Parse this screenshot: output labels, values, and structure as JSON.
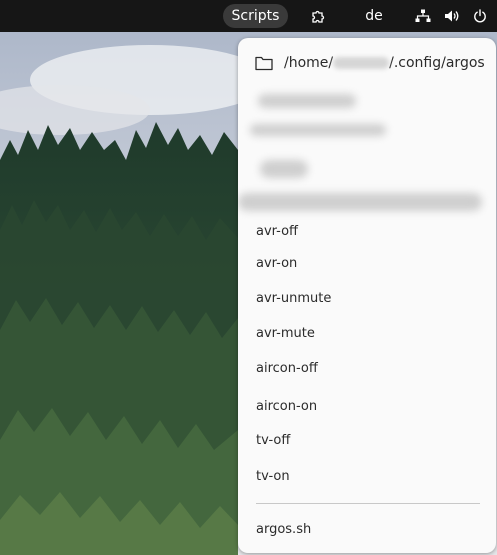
{
  "panel": {
    "scripts_label": "Scripts",
    "language_label": "de",
    "icons": [
      "extensions-icon",
      "network-icon",
      "volume-icon",
      "power-icon"
    ]
  },
  "menu": {
    "header_path_prefix": "/home/",
    "header_path_suffix": "/.config/argos",
    "items": [
      {
        "label": "avr-off"
      },
      {
        "label": "avr-on"
      },
      {
        "label": "avr-unmute"
      },
      {
        "label": "avr-mute"
      },
      {
        "label": "aircon-off"
      },
      {
        "label": "aircon-on"
      },
      {
        "label": "tv-off"
      },
      {
        "label": "tv-on"
      }
    ],
    "footer_label": "argos.sh"
  },
  "colors": {
    "panel_bg": "#161616",
    "menu_bg": "#fafafa",
    "text": "#2b2b2b"
  }
}
